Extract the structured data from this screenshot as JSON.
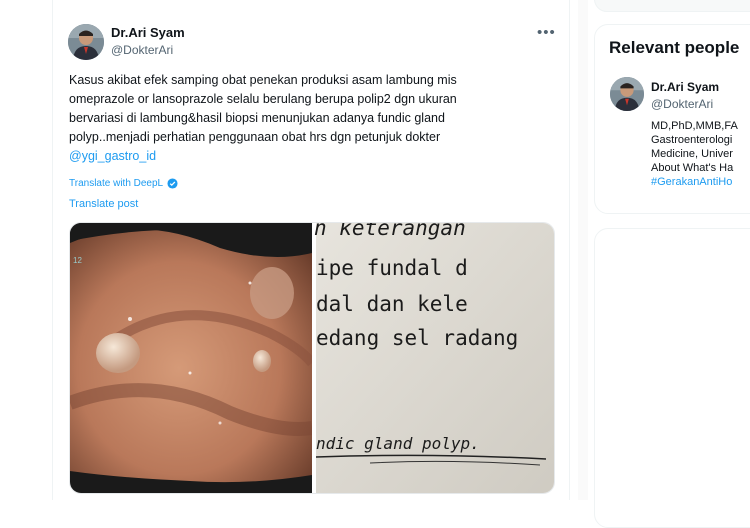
{
  "tweet": {
    "author_name": "Dr.Ari Syam",
    "author_handle": "@DokterAri",
    "text_lines": [
      "Kasus akibat efek samping obat penekan produksi asam lambung mis",
      "omeprazole or lansoprazole selalu berulang berupa polip2 dgn ukuran",
      "bervariasi di lambung&hasil biopsi menunjukan adanya fundic gland",
      "polyp..menjadi perhatian penggunaan obat hrs dgn petunjuk dokter"
    ],
    "mention": "@ygi_gastro_id",
    "translate_deepl": "Translate with DeepL",
    "translate_post": "Translate post",
    "more_icon": "more-icon",
    "media": {
      "right_image_lines": [
        "n keterangan",
        "ipe  fundal  d",
        "dal  dan  kele",
        "edang sel radang",
        "ndic gland polyp.",
        "12"
      ]
    }
  },
  "sidebar": {
    "title": "Relevant people",
    "person": {
      "name": "Dr.Ari Syam",
      "handle": "@DokterAri",
      "bio_lines": [
        "MD,PhD,MMB,FA",
        "Gastroenterologi",
        "Medicine, Univer",
        "About What's Ha"
      ],
      "hashtag": "#GerakanAntiHo"
    }
  },
  "colors": {
    "accent": "#1d9bf0",
    "text": "#0f1419",
    "muted": "#536471"
  }
}
